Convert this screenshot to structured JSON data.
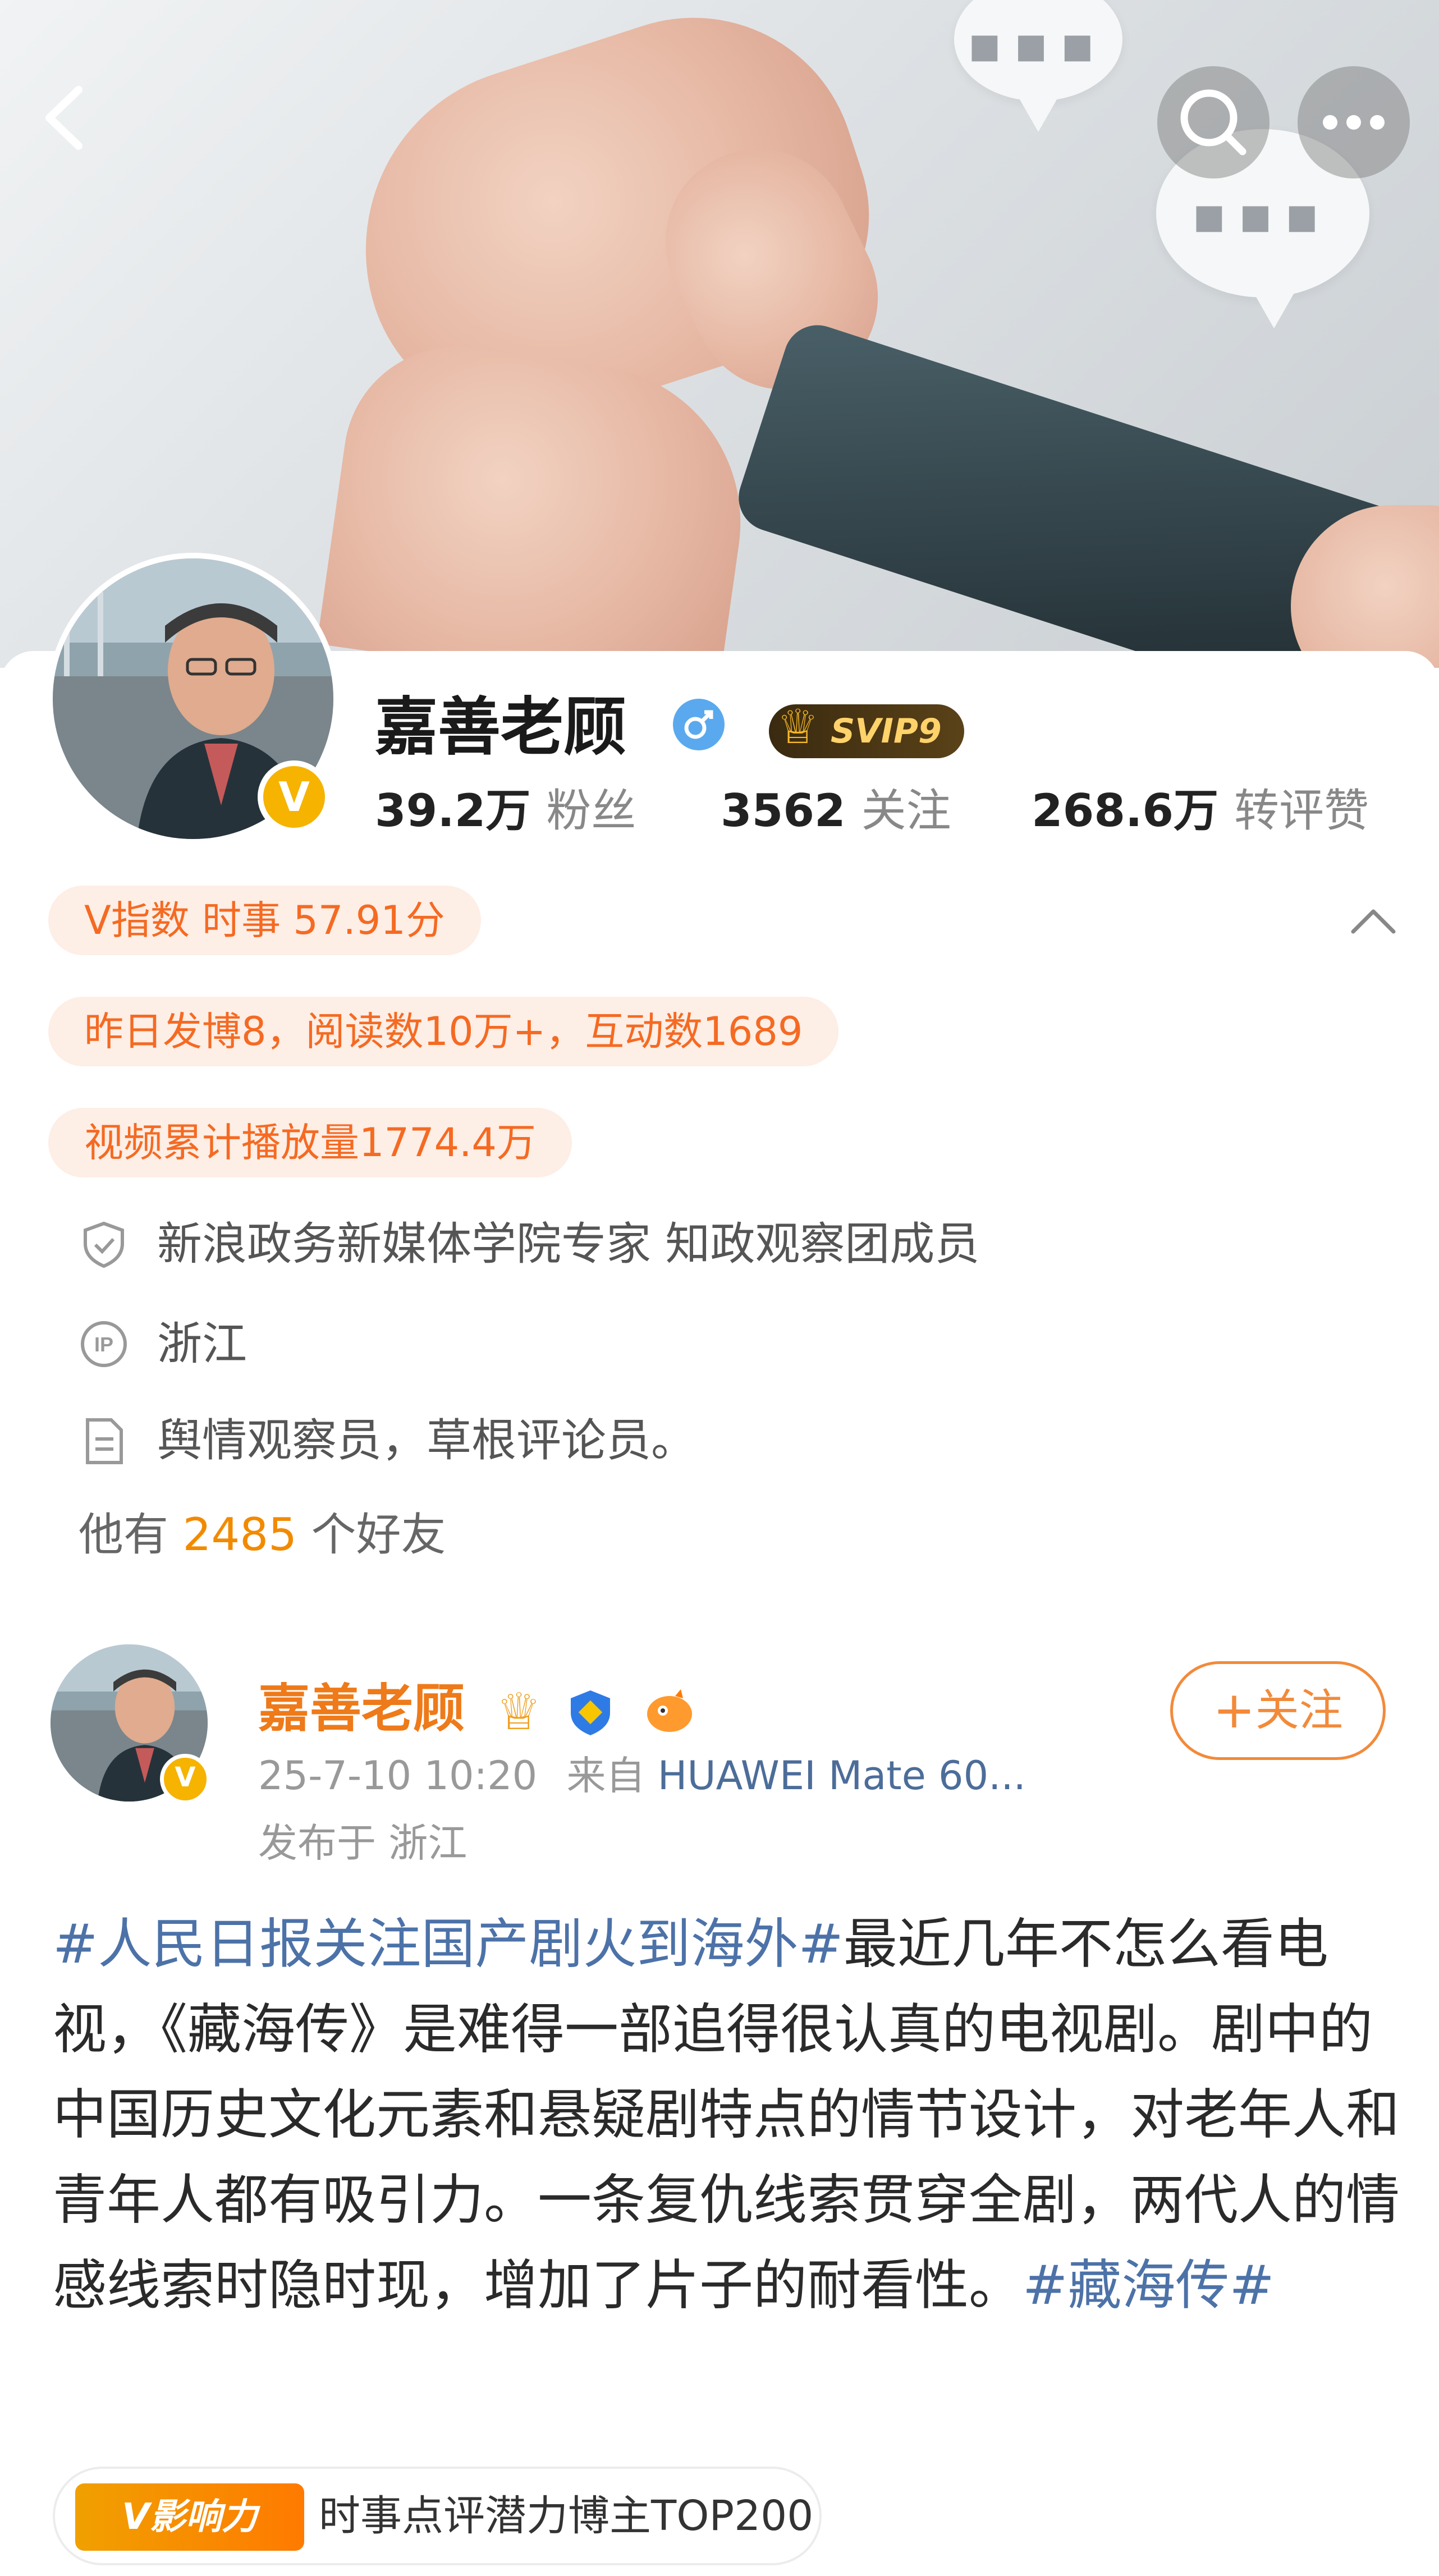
{
  "header": {
    "back_icon": "chevron-left-icon",
    "search_icon": "search-icon",
    "more_icon": "more-horizontal-icon"
  },
  "profile": {
    "name": "嘉善老顾",
    "gender_icon": "male-icon",
    "vip_badge": "SVIP9",
    "verified_badge": "V",
    "stats": [
      {
        "value": "39.2万",
        "label": "粉丝"
      },
      {
        "value": "3562",
        "label": "关注"
      },
      {
        "value": "268.6万",
        "label": "转评赞"
      }
    ],
    "v_index": "V指数 时事 57.91分",
    "yesterday": "昨日发博8，阅读数10万+，互动数1689",
    "video_plays": "视频累计播放量1774.4万",
    "collapse_icon": "chevron-up-icon",
    "info": [
      {
        "icon": "shield-icon",
        "text": "新浪政务新媒体学院专家 知政观察团成员"
      },
      {
        "icon": "ip-icon",
        "text": "浙江"
      },
      {
        "icon": "document-icon",
        "text": "舆情观察员，草根评论员。"
      }
    ],
    "friends": {
      "prefix": "他有",
      "count": "2485",
      "suffix": "个好友"
    }
  },
  "post": {
    "author": "嘉善老顾",
    "verified_badge": "V",
    "badges": [
      "crown-icon",
      "verified-shield-icon",
      "fish-icon"
    ],
    "time": "25-7-10 10:20",
    "from_label": "来自",
    "source": "HUAWEI Mate 60...",
    "location": "发布于 浙江",
    "follow_label": "关注",
    "body": [
      {
        "type": "tag",
        "text": "#人民日报关注国产剧火到海外#"
      },
      {
        "type": "text",
        "text": "最近几年不怎么看电视，《藏海传》是难得一部追得很认真的电视剧。剧中的中国历史文化元素和悬疑剧特点的情节设计，对老年人和青年人都有吸引力。一条复仇线索贯穿全剧，两代人的情感线索时隐时现，增加了片子的耐看性。"
      },
      {
        "type": "tag",
        "text": "#藏海传#"
      }
    ],
    "influence": {
      "logo_text": "V影响力",
      "label": "时事点评潜力博主TOP200"
    }
  },
  "colors": {
    "accent_orange": "#f56a22",
    "pill_bg": "#fdeee6",
    "link_blue": "#4c72a8",
    "verified_gold": "#f6b300"
  }
}
